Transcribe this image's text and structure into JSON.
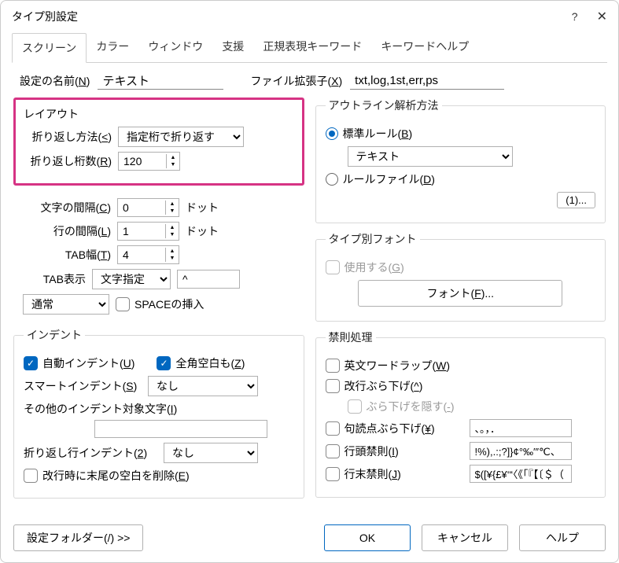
{
  "titlebar": {
    "title": "タイプ別設定"
  },
  "tabs": [
    "スクリーン",
    "カラー",
    "ウィンドウ",
    "支援",
    "正規表現キーワード",
    "キーワードヘルプ"
  ],
  "top": {
    "name_label": "設定の名前(N)",
    "name_value": "テキスト",
    "ext_label": "ファイル拡張子(X)",
    "ext_value": "txt,log,1st,err,ps"
  },
  "layout": {
    "legend": "レイアウト",
    "wrap_method_label": "折り返し方法(<)",
    "wrap_method_value": "指定桁で折り返す",
    "wrap_cols_label": "折り返し桁数(R)",
    "wrap_cols_value": "120",
    "char_space_label": "文字の間隔(C)",
    "char_space_value": "0",
    "char_space_unit": "ドット",
    "line_space_label": "行の間隔(L)",
    "line_space_value": "1",
    "line_space_unit": "ドット",
    "tab_width_label": "TAB幅(T)",
    "tab_width_value": "4",
    "tab_display_label": "TAB表示",
    "tab_display_value": "文字指定",
    "tab_char_value": "^",
    "combo_normal": "通常",
    "space_insert": "SPACEの挿入"
  },
  "indent": {
    "legend": "インデント",
    "auto_indent": "自動インデント(U)",
    "fullwidth_space": "全角空白も(Z)",
    "smart_indent_label": "スマートインデント(S)",
    "smart_indent_value": "なし",
    "other_chars_label": "その他のインデント対象文字(I)",
    "other_chars_value": "",
    "wrap_indent_label": "折り返し行インデント(2)",
    "wrap_indent_value": "なし",
    "trim_trailing": "改行時に末尾の空白を削除(E)"
  },
  "outline": {
    "legend": "アウトライン解析方法",
    "standard_rule": "標準ルール(B)",
    "standard_value": "テキスト",
    "rule_file": "ルールファイル(D)",
    "one_btn": "(1)..."
  },
  "typefont": {
    "legend": "タイプ別フォント",
    "use_label": "使用する(G)",
    "font_btn": "フォント(F)..."
  },
  "kinsoku": {
    "legend": "禁則処理",
    "wordwrap": "英文ワードラップ(W)",
    "hanging": "改行ぶら下げ(^)",
    "hide_hanging": "ぶら下げを隠す(-)",
    "punct_hanging": "句読点ぶら下げ(¥)",
    "punct_chars": "、。，．",
    "line_head": "行頭禁則(I)",
    "line_head_chars": "!%),.:;?]}¢°‰′″℃、",
    "line_tail": "行末禁則(J)",
    "line_tail_chars": "$([¥{£¥‘“〈《「『【〔＄（"
  },
  "footer": {
    "folder": "設定フォルダー(/) >>",
    "ok": "OK",
    "cancel": "キャンセル",
    "help": "ヘルプ"
  }
}
